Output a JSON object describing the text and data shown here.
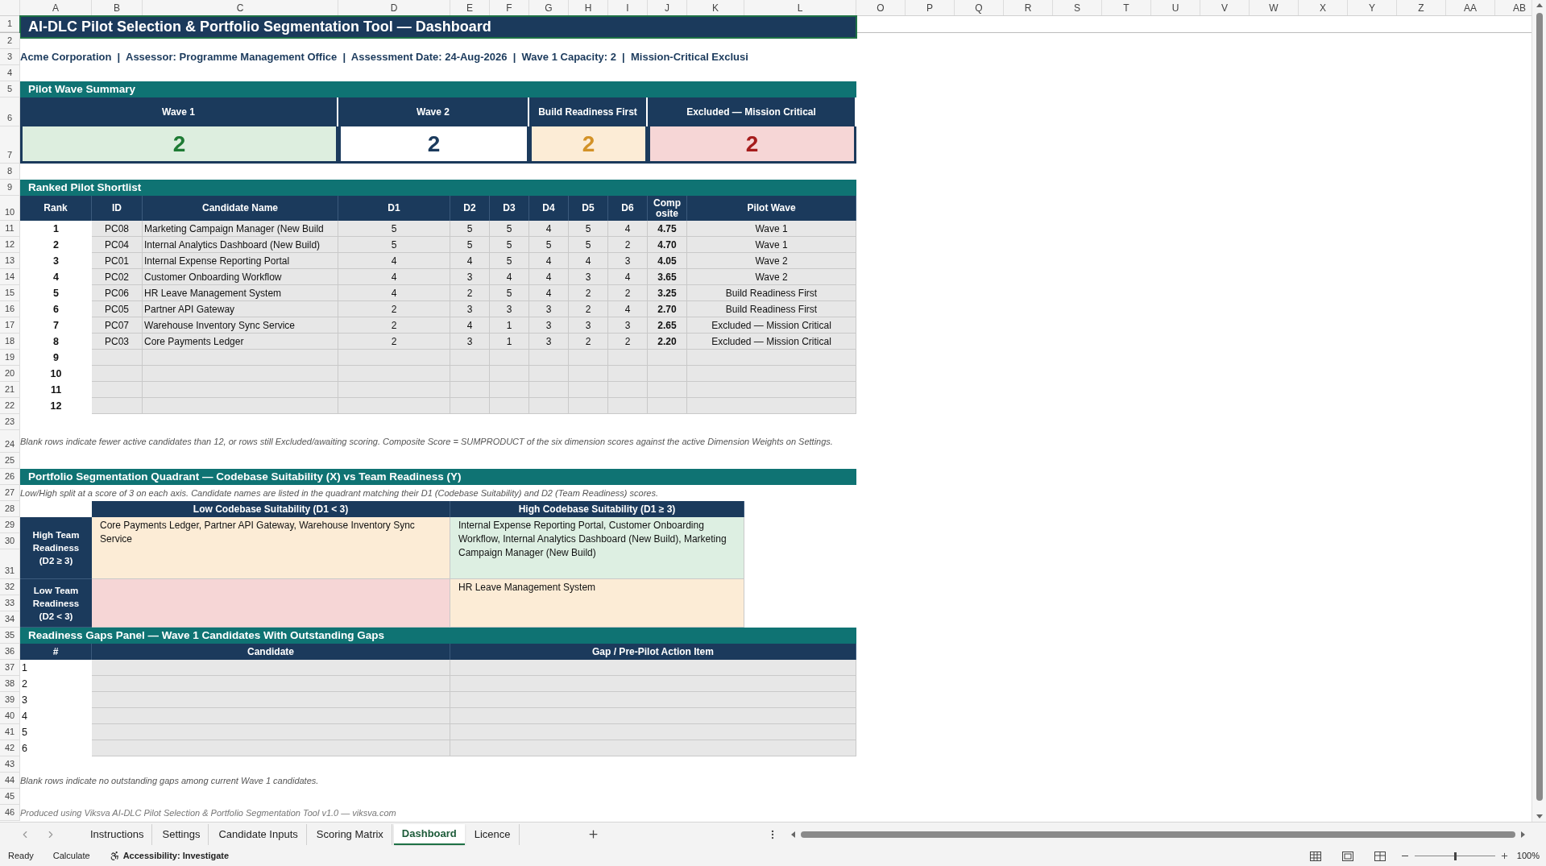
{
  "sheet": {
    "columns": [
      "A",
      "B",
      "C",
      "D",
      "E",
      "F",
      "G",
      "H",
      "I",
      "J",
      "K",
      "L",
      "O",
      "P",
      "Q",
      "R",
      "S",
      "T",
      "U",
      "V",
      "W",
      "X",
      "Y",
      "Z",
      "AA",
      "AB"
    ],
    "row_numbers": [
      "1",
      "2",
      "3",
      "4",
      "5",
      "6",
      "7",
      "8",
      "9",
      "10",
      "11",
      "12",
      "13",
      "14",
      "15",
      "16",
      "17",
      "18",
      "19",
      "20",
      "21",
      "22",
      "23",
      "24",
      "25",
      "26",
      "27",
      "28",
      "29",
      "30",
      "31",
      "32",
      "33",
      "34",
      "35",
      "36",
      "37",
      "38",
      "39",
      "40",
      "41",
      "42",
      "43",
      "44",
      "45",
      "46"
    ]
  },
  "title": "AI-DLC Pilot Selection & Portfolio Segmentation Tool — Dashboard",
  "info_line": "Acme Corporation  |  Assessor: Programme Management Office  |  Assessment Date: 24-Aug-2026  |  Wave 1 Capacity: 2  |  Mission-Critical Exclusi",
  "wave_summary": {
    "title": "Pilot Wave Summary",
    "cards": [
      {
        "kind": "wave_1",
        "label": "Wave 1",
        "value": "2"
      },
      {
        "kind": "wave_2",
        "label": "Wave 2",
        "value": "2"
      },
      {
        "kind": "readiness",
        "label": "Build Readiness First",
        "value": "2"
      },
      {
        "kind": "excluded",
        "label": "Excluded — Mission Critical",
        "value": "2"
      }
    ]
  },
  "shortlist": {
    "title": "Ranked Pilot Shortlist",
    "columns": [
      "Rank",
      "ID",
      "Candidate Name",
      "D1",
      "D2",
      "D3",
      "D4",
      "D5",
      "D6",
      "Composite",
      "Pilot Wave"
    ],
    "rows": [
      {
        "rank": "1",
        "id": "PC08",
        "name": "Marketing Campaign Manager (New Build",
        "scores": [
          "5",
          "5",
          "5",
          "4",
          "5",
          "4"
        ],
        "composite": "4.75",
        "wave": "Wave 1"
      },
      {
        "rank": "2",
        "id": "PC04",
        "name": "Internal Analytics Dashboard (New Build)",
        "scores": [
          "5",
          "5",
          "5",
          "5",
          "5",
          "2"
        ],
        "composite": "4.70",
        "wave": "Wave 1"
      },
      {
        "rank": "3",
        "id": "PC01",
        "name": "Internal Expense Reporting Portal",
        "scores": [
          "4",
          "4",
          "5",
          "4",
          "4",
          "3"
        ],
        "composite": "4.05",
        "wave": "Wave 2"
      },
      {
        "rank": "4",
        "id": "PC02",
        "name": "Customer Onboarding Workflow",
        "scores": [
          "4",
          "3",
          "4",
          "4",
          "3",
          "4"
        ],
        "composite": "3.65",
        "wave": "Wave 2"
      },
      {
        "rank": "5",
        "id": "PC06",
        "name": "HR Leave Management System",
        "scores": [
          "4",
          "2",
          "5",
          "4",
          "2",
          "2"
        ],
        "composite": "3.25",
        "wave": "Build Readiness First"
      },
      {
        "rank": "6",
        "id": "PC05",
        "name": "Partner API Gateway",
        "scores": [
          "2",
          "3",
          "3",
          "3",
          "2",
          "4"
        ],
        "composite": "2.70",
        "wave": "Build Readiness First"
      },
      {
        "rank": "7",
        "id": "PC07",
        "name": "Warehouse Inventory Sync Service",
        "scores": [
          "2",
          "4",
          "1",
          "3",
          "3",
          "3"
        ],
        "composite": "2.65",
        "wave": "Excluded — Mission Critical"
      },
      {
        "rank": "8",
        "id": "PC03",
        "name": "Core Payments Ledger",
        "scores": [
          "2",
          "3",
          "1",
          "3",
          "2",
          "2"
        ],
        "composite": "2.20",
        "wave": "Excluded — Mission Critical"
      },
      {
        "rank": "9"
      },
      {
        "rank": "10"
      },
      {
        "rank": "11"
      },
      {
        "rank": "12"
      }
    ],
    "note": "Blank rows indicate fewer active candidates than 12, or rows still Excluded/awaiting scoring. Composite Score = SUMPRODUCT of the six dimension scores against the active Dimension Weights on Settings."
  },
  "quadrant": {
    "title": "Portfolio Segmentation Quadrant — Codebase Suitability (X) vs Team Readiness (Y)",
    "note": "Low/High split at a score of 3 on each axis. Candidate names are listed in the quadrant matching their D1 (Codebase Suitability) and D2 (Team Readiness) scores.",
    "column_headers": [
      "Low Codebase Suitability (D1 < 3)",
      "High Codebase Suitability (D1 ≥ 3)"
    ],
    "rows": [
      {
        "label": "High Team Readiness (D2 ≥ 3)",
        "cells": [
          {
            "text": "Core Payments Ledger, Partner API Gateway, Warehouse Inventory Sync Service",
            "color": "#fcecd6"
          },
          {
            "text": "Internal Expense Reporting Portal, Customer Onboarding Workflow, Internal Analytics Dashboard (New Build), Marketing Campaign Manager (New Build)",
            "color": "#ddefe2"
          }
        ]
      },
      {
        "label": "Low Team Readiness (D2 < 3)",
        "cells": [
          {
            "color": "#f6d6d6"
          },
          {
            "text": "HR Leave Management System",
            "color": "#fcecd6"
          }
        ]
      }
    ]
  },
  "gaps": {
    "title": "Readiness Gaps Panel — Wave 1 Candidates With Outstanding Gaps",
    "columns": [
      "#",
      "Candidate",
      "Gap / Pre-Pilot Action Item"
    ],
    "rows": [
      "1",
      "2",
      "3",
      "4",
      "5",
      "6"
    ],
    "note": "Blank rows indicate no outstanding gaps among current Wave 1 candidates."
  },
  "footer": "Produced using Viksva AI-DLC Pilot Selection & Portfolio Segmentation Tool v1.0 — viksva.com",
  "sheet_tabs": [
    {
      "label": "Instructions",
      "selected": false
    },
    {
      "label": "Settings",
      "selected": false
    },
    {
      "label": "Candidate Inputs",
      "selected": false
    },
    {
      "label": "Scoring Matrix",
      "selected": false
    },
    {
      "label": "Dashboard",
      "selected": true
    },
    {
      "label": "Licence",
      "selected": false
    }
  ],
  "status_bar": {
    "ready": "Ready",
    "calculate": "Calculate",
    "accessibility": "Accessibility: Investigate",
    "zoom": "100%",
    "zoom_slider": {
      "level": 0.5
    }
  }
}
